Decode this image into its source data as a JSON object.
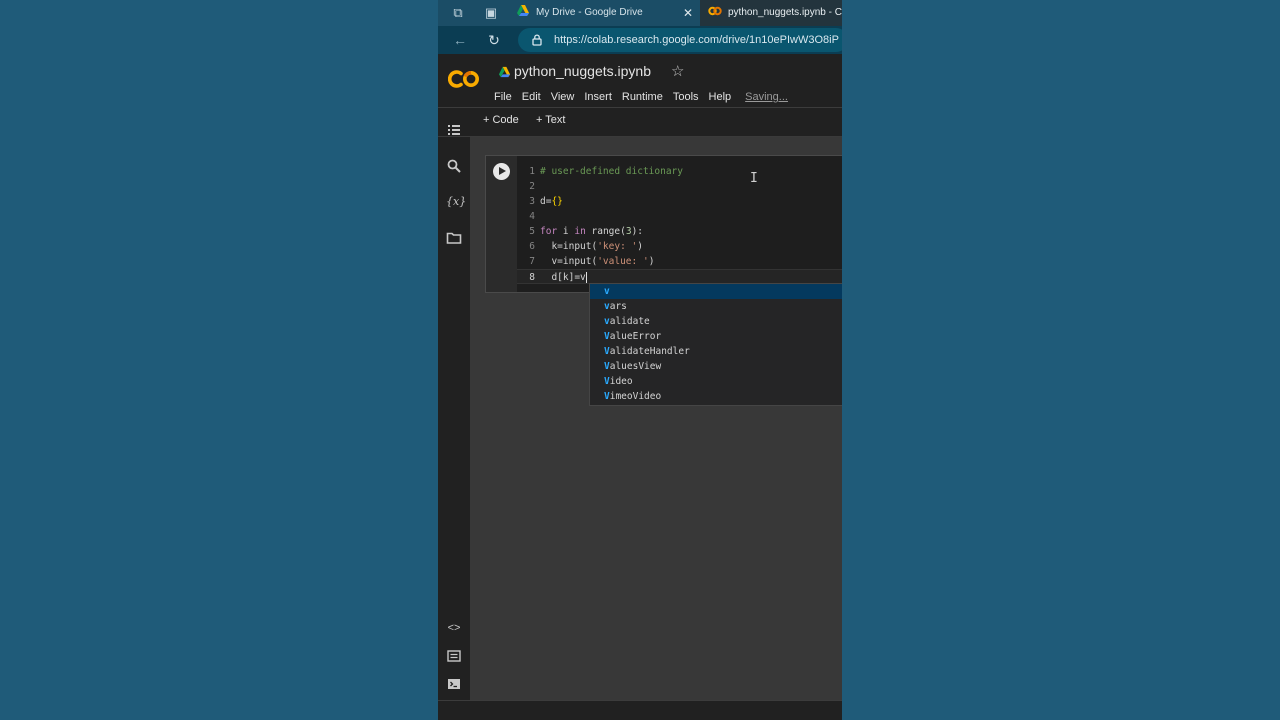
{
  "browser": {
    "tabs": [
      {
        "title": "My Drive - Google Drive",
        "active": false
      },
      {
        "title": "python_nuggets.ipynb - Co",
        "active": true
      }
    ],
    "url": "https://colab.research.google.com/drive/1n10ePIwW3O8iP"
  },
  "colab": {
    "logo_text": "CO",
    "notebook_title": "python_nuggets.ipynb",
    "menu": [
      "File",
      "Edit",
      "View",
      "Insert",
      "Runtime",
      "Tools",
      "Help"
    ],
    "status": "Saving...",
    "toolbar": {
      "code_label": "+ Code",
      "text_label": "+ Text"
    }
  },
  "sidebar_icons": [
    "table-of-contents-icon",
    "search-icon",
    "variables-icon",
    "folder-icon",
    "code-snippets-icon",
    "command-palette-icon",
    "terminal-icon"
  ],
  "code_cell": {
    "line_numbers": [
      "1",
      "2",
      "3",
      "4",
      "5",
      "6",
      "7",
      "8"
    ],
    "lines": [
      "# user-defined dictionary",
      "",
      "d={}",
      "",
      "for i in range(3):",
      "  k=input('key: ')",
      "  v=input('value: ')",
      "  d[k]=v"
    ]
  },
  "autocomplete": {
    "typed_prefix": "v",
    "items": [
      "v",
      "vars",
      "validate",
      "ValueError",
      "ValidateHandler",
      "ValuesView",
      "Video",
      "VimeoVideo"
    ],
    "selected_index": 0
  },
  "colors": {
    "desktop": "#1f5b79",
    "accent_orange": "#f9ab00",
    "comment_green": "#6a9955",
    "keyword_purple": "#c586c0",
    "string_orange": "#ce9178",
    "match_blue": "#2aaaff"
  }
}
